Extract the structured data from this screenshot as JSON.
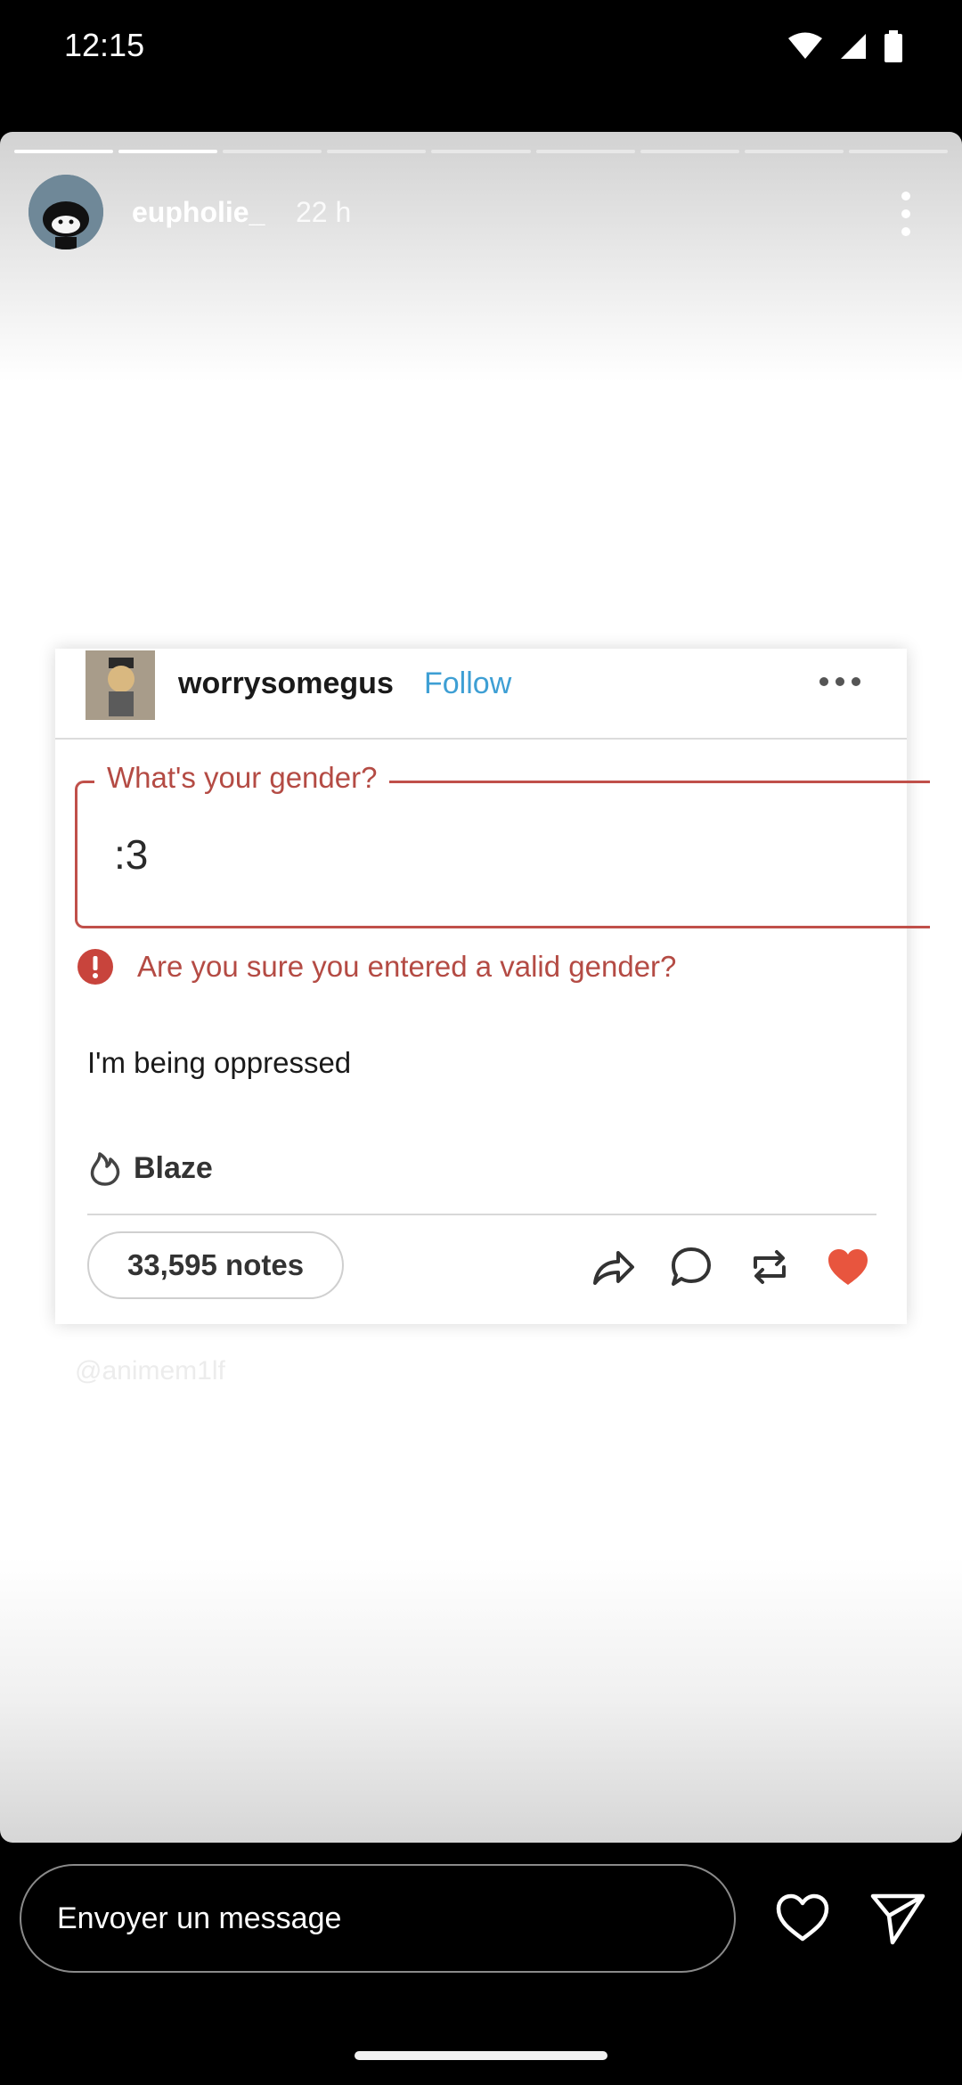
{
  "status_bar": {
    "time": "12:15"
  },
  "story": {
    "segments_total": 9,
    "segments_done": 2,
    "username": "eupholie_",
    "age": "22 h"
  },
  "post": {
    "blog_name": "worrysomegus",
    "follow_label": "Follow",
    "field_label": "What's your gender?",
    "field_value": ":3",
    "error_text": "Are you sure you entered a valid gender?",
    "text": "I'm being oppressed",
    "blaze_label": "Blaze",
    "notes": "33,595 notes",
    "watermark": "@animem1lf"
  },
  "footer": {
    "message_placeholder": "Envoyer un message"
  },
  "colors": {
    "error": "#b44b44",
    "follow": "#3e9fd4",
    "like": "#e8553e"
  }
}
